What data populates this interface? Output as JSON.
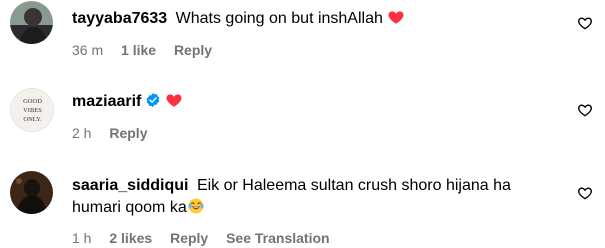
{
  "comments": [
    {
      "username": "tayyaba7633",
      "text": "Whats going on but inshAllah",
      "emoji": "red-heart",
      "time": "36 m",
      "likes": "1 like",
      "reply": "Reply",
      "avatar": "profile-photo"
    },
    {
      "username": "maziaarif",
      "verified": true,
      "text": "",
      "emoji": "red-heart",
      "time": "2 h",
      "reply": "Reply",
      "avatar_logo_text": "GOOD VIBES ONLY."
    },
    {
      "username": "saaria_siddiqui",
      "text_line1": "Eik or Haleema sultan crush shoro hijana ha",
      "text_line2": "humari qoom ka",
      "emoji": "laughing-crying",
      "time": "1 h",
      "likes": "2 likes",
      "reply": "Reply",
      "see_translation": "See Translation",
      "avatar": "profile-photo"
    }
  ],
  "colors": {
    "meta_text": "#737373",
    "heart_red": "#ff3040",
    "verified_blue": "#0095f6"
  },
  "icons": {
    "like": "heart-outline-icon",
    "verified": "verified-badge-icon"
  }
}
